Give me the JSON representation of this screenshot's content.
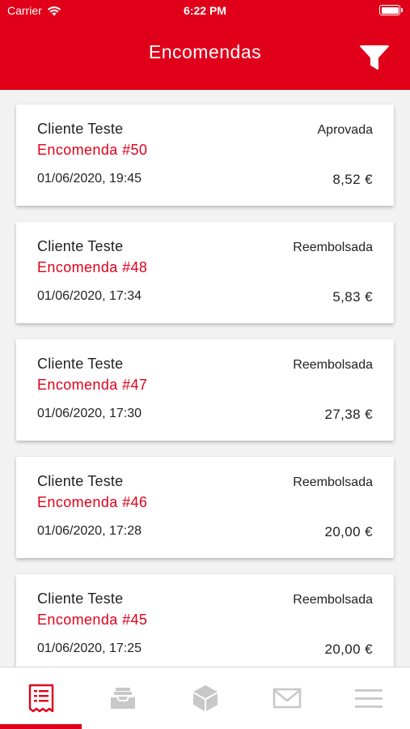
{
  "status_bar": {
    "carrier": "Carrier",
    "time": "6:22 PM"
  },
  "header": {
    "title": "Encomendas",
    "filter_icon": "filter-icon"
  },
  "orders": [
    {
      "client": "Cliente Teste",
      "order": "Encomenda #50",
      "date": "01/06/2020, 19:45",
      "status": "Aprovada",
      "amount": "8,52 €"
    },
    {
      "client": "Cliente Teste",
      "order": "Encomenda #48",
      "date": "01/06/2020, 17:34",
      "status": "Reembolsada",
      "amount": "5,83 €"
    },
    {
      "client": "Cliente Teste",
      "order": "Encomenda #47",
      "date": "01/06/2020, 17:30",
      "status": "Reembolsada",
      "amount": "27,38 €"
    },
    {
      "client": "Cliente Teste",
      "order": "Encomenda #46",
      "date": "01/06/2020, 17:28",
      "status": "Reembolsada",
      "amount": "20,00 €"
    },
    {
      "client": "Cliente Teste",
      "order": "Encomenda #45",
      "date": "01/06/2020, 17:25",
      "status": "Reembolsada",
      "amount": "20,00 €"
    }
  ],
  "tab_bar": {
    "tabs": [
      {
        "icon": "receipt-icon",
        "active": true
      },
      {
        "icon": "inbox-tray-icon",
        "active": false
      },
      {
        "icon": "box-icon",
        "active": false
      },
      {
        "icon": "mail-icon",
        "active": false
      },
      {
        "icon": "menu-icon",
        "active": false
      }
    ]
  },
  "colors": {
    "brand": "#e0001a",
    "inactive_icon": "#c8c8c8"
  }
}
